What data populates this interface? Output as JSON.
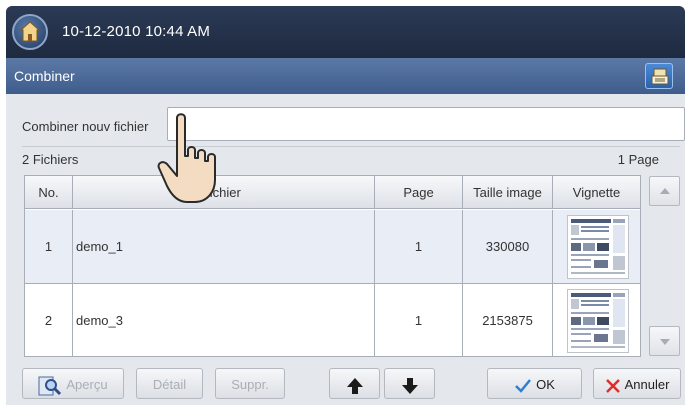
{
  "status_bar": {
    "datetime": "10-12-2010 10:44 AM"
  },
  "title_bar": {
    "title": "Combiner"
  },
  "form": {
    "name_label": "Combiner nouv fichier",
    "name_value": "",
    "files_count": "2 Fichiers",
    "page_count": "1 Page"
  },
  "table": {
    "headers": [
      "No.",
      "Nom fichier",
      "Page",
      "Taille image",
      "Vignette"
    ],
    "header_visible_name": "fichier",
    "rows": [
      {
        "no": "1",
        "name": "demo_1",
        "page": "1",
        "size": "330080"
      },
      {
        "no": "2",
        "name": "demo_3",
        "page": "1",
        "size": "2153875"
      }
    ]
  },
  "buttons": {
    "preview": "Aperçu",
    "detail": "Détail",
    "delete": "Suppr.",
    "ok": "OK",
    "cancel": "Annuler"
  },
  "icons": {
    "home": "home-icon",
    "title_action": "document-stack-icon",
    "preview": "magnifier-document-icon",
    "move_up": "arrow-up-icon",
    "move_down": "arrow-down-icon",
    "ok": "checkmark-icon",
    "cancel": "x-icon"
  },
  "colors": {
    "top_bar": "#1e2a40",
    "title_bar": "#3f5d8c",
    "ok_check": "#2f7fd9",
    "cancel_x": "#d9302a"
  }
}
